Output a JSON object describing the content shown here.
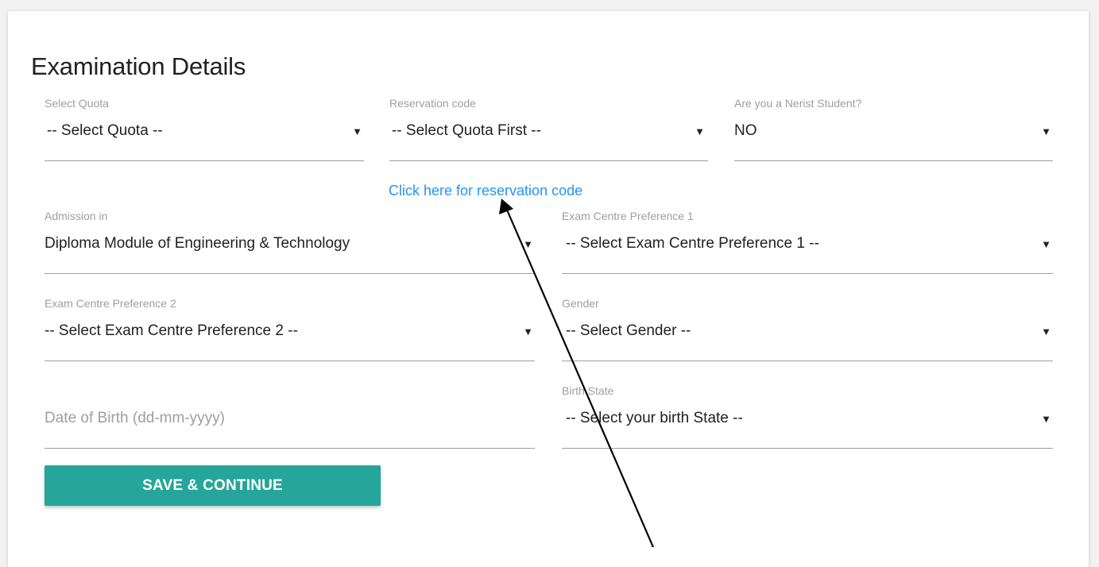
{
  "form": {
    "title": "Examination Details",
    "fields": {
      "quota": {
        "label": "Select Quota",
        "value": "-- Select Quota --"
      },
      "reservation": {
        "label": "Reservation code",
        "value": "-- Select Quota First --"
      },
      "nerist": {
        "label": "Are you a Nerist Student?",
        "value": "NO"
      },
      "admission": {
        "label": "Admission in",
        "value": "Diploma Module of Engineering & Technology"
      },
      "centre1": {
        "label": "Exam Centre Preference 1",
        "value": "-- Select Exam Centre Preference 1 --"
      },
      "centre2": {
        "label": "Exam Centre Preference 2",
        "value": "-- Select Exam Centre Preference 2 --"
      },
      "gender": {
        "label": "Gender",
        "value": "-- Select Gender --"
      },
      "dob": {
        "placeholder": "Date of Birth (dd-mm-yyyy)"
      },
      "birth_state": {
        "label": "Birth State",
        "value": "-- Select your birth State --"
      }
    },
    "reservation_link": "Click here for reservation code",
    "submit_label": "SAVE & CONTINUE",
    "caret_glyph": "▼"
  },
  "colors": {
    "accent": "#26a69a",
    "link": "#2196f3",
    "label": "#9e9e9e",
    "text": "#212121"
  },
  "icons": [
    "dropdown-caret-icon",
    "annotation-arrow-icon"
  ]
}
